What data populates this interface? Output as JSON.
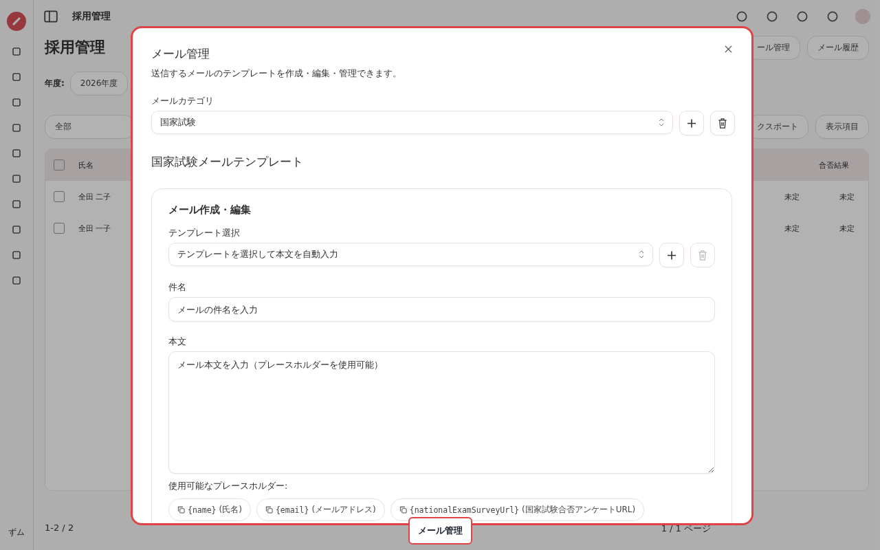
{
  "background": {
    "app_title": "採用管理",
    "page_title": "採用管理",
    "year_label": "年度:",
    "year_value": "2026年度",
    "header_buttons": [
      "ール管理",
      "メール履歴"
    ],
    "search_placeholder": "全部",
    "toolbar_buttons": [
      "クスポート",
      "表示項目"
    ],
    "columns": [
      "氏名",
      "合否結果"
    ],
    "all_checked": false,
    "rows": [
      {
        "name": "全田 二子",
        "result": "未定",
        "extra": "未定",
        "checked": false
      },
      {
        "name": "全田 一子",
        "result": "未定",
        "extra": "未定",
        "checked": false
      }
    ],
    "count": "1-2 / 2",
    "page": "1 / 1 ページ",
    "user_initials": "ずム"
  },
  "dialog": {
    "title": "メール管理",
    "description": "送信するメールのテンプレートを作成・編集・管理できます。",
    "category": {
      "label": "メールカテゴリ",
      "value": "国家試験",
      "delete_disabled": false
    },
    "section_title": "国家試験メールテンプレート",
    "editor": {
      "title": "メール作成・編集",
      "template": {
        "label": "テンプレート選択",
        "placeholder": "テンプレートを選択して本文を自動入力",
        "delete_disabled": true
      },
      "subject": {
        "label": "件名",
        "placeholder": "メールの件名を入力"
      },
      "body": {
        "label": "本文",
        "placeholder": "メール本文を入力（プレースホルダーを使用可能）"
      },
      "placeholders_label": "使用可能なプレースホルダー:",
      "placeholders": [
        {
          "code": "{name}",
          "label": "(氏名)"
        },
        {
          "code": "{email}",
          "label": "(メールアドレス)"
        },
        {
          "code": "{nationalExamSurveyUrl}",
          "label": "(国家試験合否アンケートURL)"
        }
      ]
    }
  },
  "tooltip": {
    "text": "メール管理"
  }
}
